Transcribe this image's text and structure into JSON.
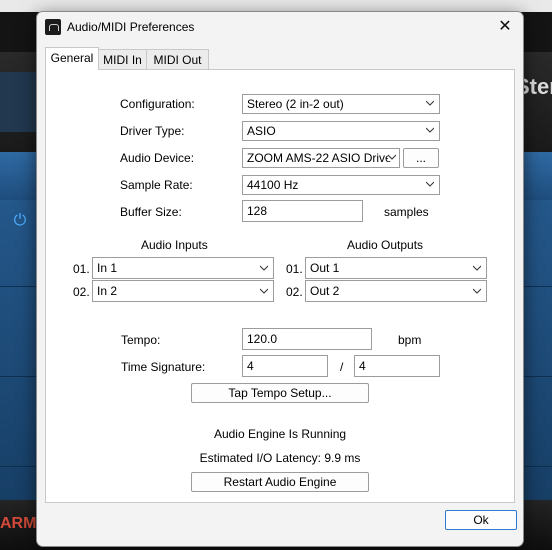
{
  "window": {
    "title": "Audio/MIDI Preferences",
    "close_glyph": "✕"
  },
  "background": {
    "partial_text_right": "Ster",
    "partial_text_bottom": "ARM"
  },
  "tabs": [
    {
      "label": "General",
      "active": true
    },
    {
      "label": "MIDI In",
      "active": false
    },
    {
      "label": "MIDI Out",
      "active": false
    }
  ],
  "settings": {
    "configuration": {
      "label": "Configuration:",
      "value": "Stereo (2 in-2 out)"
    },
    "driver_type": {
      "label": "Driver Type:",
      "value": "ASIO"
    },
    "audio_device": {
      "label": "Audio Device:",
      "value": "ZOOM AMS-22 ASIO Drive",
      "more_label": "..."
    },
    "sample_rate": {
      "label": "Sample Rate:",
      "value": "44100 Hz"
    },
    "buffer_size": {
      "label": "Buffer Size:",
      "value": "128",
      "unit": "samples"
    }
  },
  "inputs": {
    "heading": "Audio Inputs",
    "rows": [
      {
        "index": "01.",
        "value": "In 1"
      },
      {
        "index": "02.",
        "value": "In 2"
      }
    ]
  },
  "outputs": {
    "heading": "Audio Outputs",
    "rows": [
      {
        "index": "01.",
        "value": "Out 1"
      },
      {
        "index": "02.",
        "value": "Out 2"
      }
    ]
  },
  "tempo": {
    "label": "Tempo:",
    "value": "120.0",
    "unit": "bpm"
  },
  "time_signature": {
    "label": "Time Signature:",
    "numerator": "4",
    "separator": "/",
    "denominator": "4"
  },
  "tap_tempo_button": "Tap Tempo Setup...",
  "engine": {
    "status": "Audio Engine Is Running",
    "latency": "Estimated I/O Latency: 9.9 ms",
    "restart_button": "Restart Audio Engine"
  },
  "ok_button": "Ok"
}
